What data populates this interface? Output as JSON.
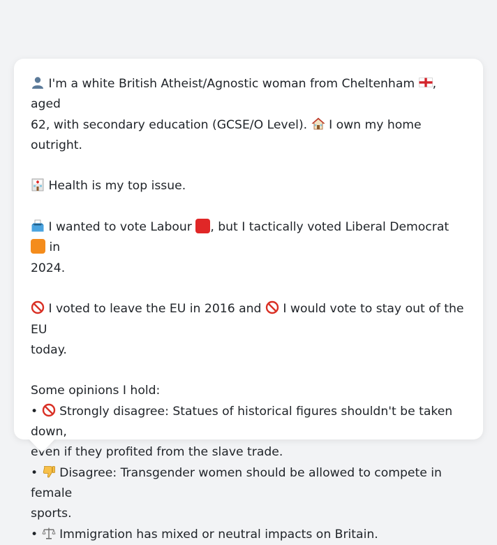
{
  "message": {
    "intro_line_1": "I'm a white British Atheist/Agnostic woman from Cheltenham",
    "intro_line_1_tail": ", aged",
    "intro_line_2": "62, with secondary education (GCSE/O Level).",
    "intro_line_2_tail": "I own my home outright.",
    "health": "Health is my top issue.",
    "vote_a": "I wanted to vote Labour",
    "vote_b": ", but I tactically voted Liberal Democrat",
    "vote_c": "in",
    "vote_d": "2024.",
    "eu_a": "I voted to leave the EU in 2016 and",
    "eu_b": "I would vote to stay out of the EU",
    "eu_c": "today.",
    "opinions_heading": "Some opinions I hold:",
    "opinions": [
      {
        "bullet": "•",
        "line1": "Strongly disagree: Statues of historical figures shouldn't be taken down,",
        "line2": "even if they profited from the slave trade."
      },
      {
        "bullet": "•",
        "line1": "Disagree: Transgender women should be allowed to compete in female",
        "line2": "sports."
      },
      {
        "bullet": "•",
        "line1": "Immigration has mixed or neutral impacts on Britain.",
        "line2": ""
      }
    ]
  },
  "icons": {
    "person": "bust-in-silhouette-icon",
    "england_flag": "england-flag-icon",
    "house": "house-icon",
    "hospital": "hospital-icon",
    "ballot": "ballot-box-icon",
    "labour": "red-square-icon",
    "libdem": "orange-square-icon",
    "no_entry": "prohibited-icon",
    "thumbs_down": "thumbs-down-icon",
    "scales": "balance-scale-icon"
  },
  "colors": {
    "page_background": "#f2f3f5",
    "bubble_background": "#ffffff",
    "text": "#1f2328",
    "labour_red": "#e02727",
    "libdem_orange": "#f48c1c",
    "prohibited_red": "#d93025"
  }
}
